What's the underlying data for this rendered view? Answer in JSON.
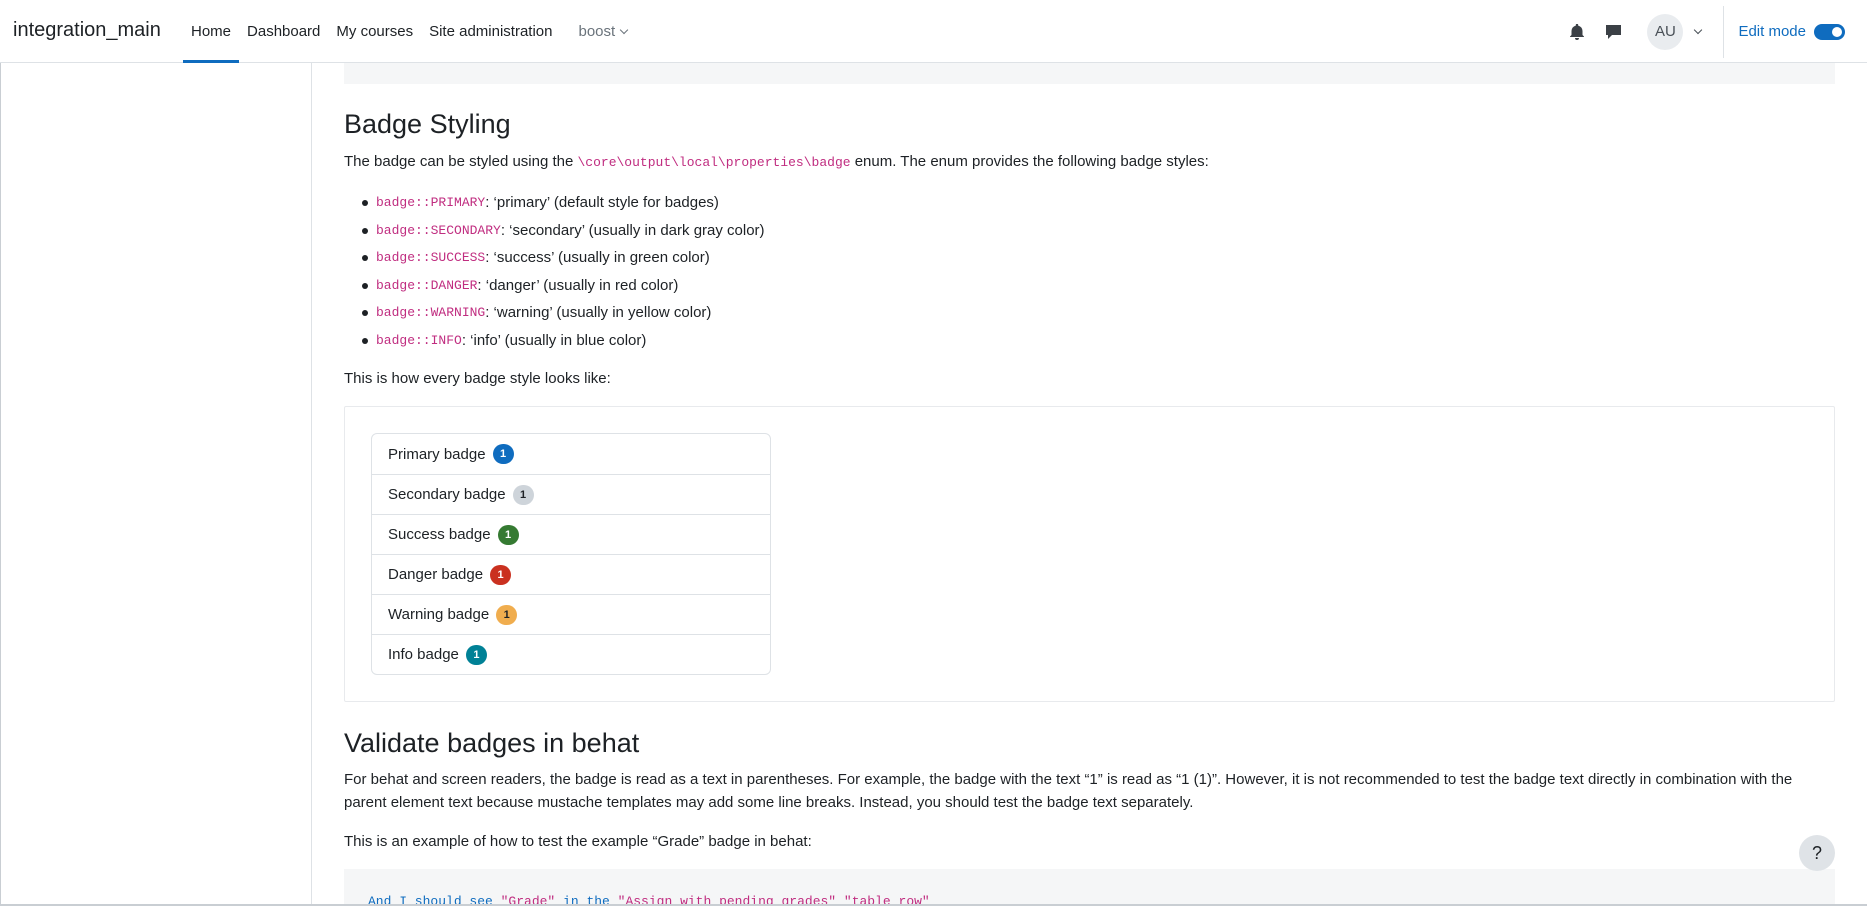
{
  "navbar": {
    "brand": "integration_main",
    "links": [
      {
        "label": "Home"
      },
      {
        "label": "Dashboard"
      },
      {
        "label": "My courses"
      },
      {
        "label": "Site administration"
      },
      {
        "label": "boost"
      }
    ],
    "avatar_initials": "AU",
    "edit_mode_label": "Edit mode",
    "edit_mode_on": true
  },
  "section_styling": {
    "heading": "Badge Styling",
    "intro_before": "The badge can be styled using the ",
    "intro_code": "\\core\\output\\local\\properties\\badge",
    "intro_after": " enum. The enum provides the following badge styles:",
    "styles": [
      {
        "code": "badge::PRIMARY",
        "desc": ": ‘primary’ (default style for badges)"
      },
      {
        "code": "badge::SECONDARY",
        "desc": ": ‘secondary’ (usually in dark gray color)"
      },
      {
        "code": "badge::SUCCESS",
        "desc": ": ‘success’ (usually in green color)"
      },
      {
        "code": "badge::DANGER",
        "desc": ": ‘danger’ (usually in red color)"
      },
      {
        "code": "badge::WARNING",
        "desc": ": ‘warning’ (usually in yellow color)"
      },
      {
        "code": "badge::INFO",
        "desc": ": ‘info’ (usually in blue color)"
      }
    ],
    "looks_like": "This is how every badge style looks like:"
  },
  "example_badges": [
    {
      "label": "Primary badge",
      "count": "1",
      "bg": "#0f6cbf",
      "fg": "#ffffff"
    },
    {
      "label": "Secondary badge",
      "count": "1",
      "bg": "#ced4da",
      "fg": "#1d2125"
    },
    {
      "label": "Success badge",
      "count": "1",
      "bg": "#357a32",
      "fg": "#ffffff"
    },
    {
      "label": "Danger badge",
      "count": "1",
      "bg": "#ca3120",
      "fg": "#ffffff"
    },
    {
      "label": "Warning badge",
      "count": "1",
      "bg": "#f0ad4e",
      "fg": "#1d2125"
    },
    {
      "label": "Info badge",
      "count": "1",
      "bg": "#008196",
      "fg": "#ffffff"
    }
  ],
  "section_behat": {
    "heading": "Validate badges in behat",
    "para1": "For behat and screen readers, the badge is read as a text in parentheses. For example, the badge with the text “1” is read as “1 (1)”. However, it is not recommended to test the badge text directly in combination with the parent element text because mustache templates may add some line breaks. Instead, you should test the badge text separately.",
    "para2": "This is an example of how to test the example “Grade” badge in behat:",
    "code_kw": "And I should see ",
    "code_s1": "\"Grade\"",
    "code_mid": " in the ",
    "code_s2": "\"Assign with pending grades\"",
    "code_sep": " ",
    "code_s3": "\"table_row\""
  },
  "help_button": "?",
  "colors": {
    "accent": "#0f6cbf",
    "code_pink": "#c02d80"
  }
}
